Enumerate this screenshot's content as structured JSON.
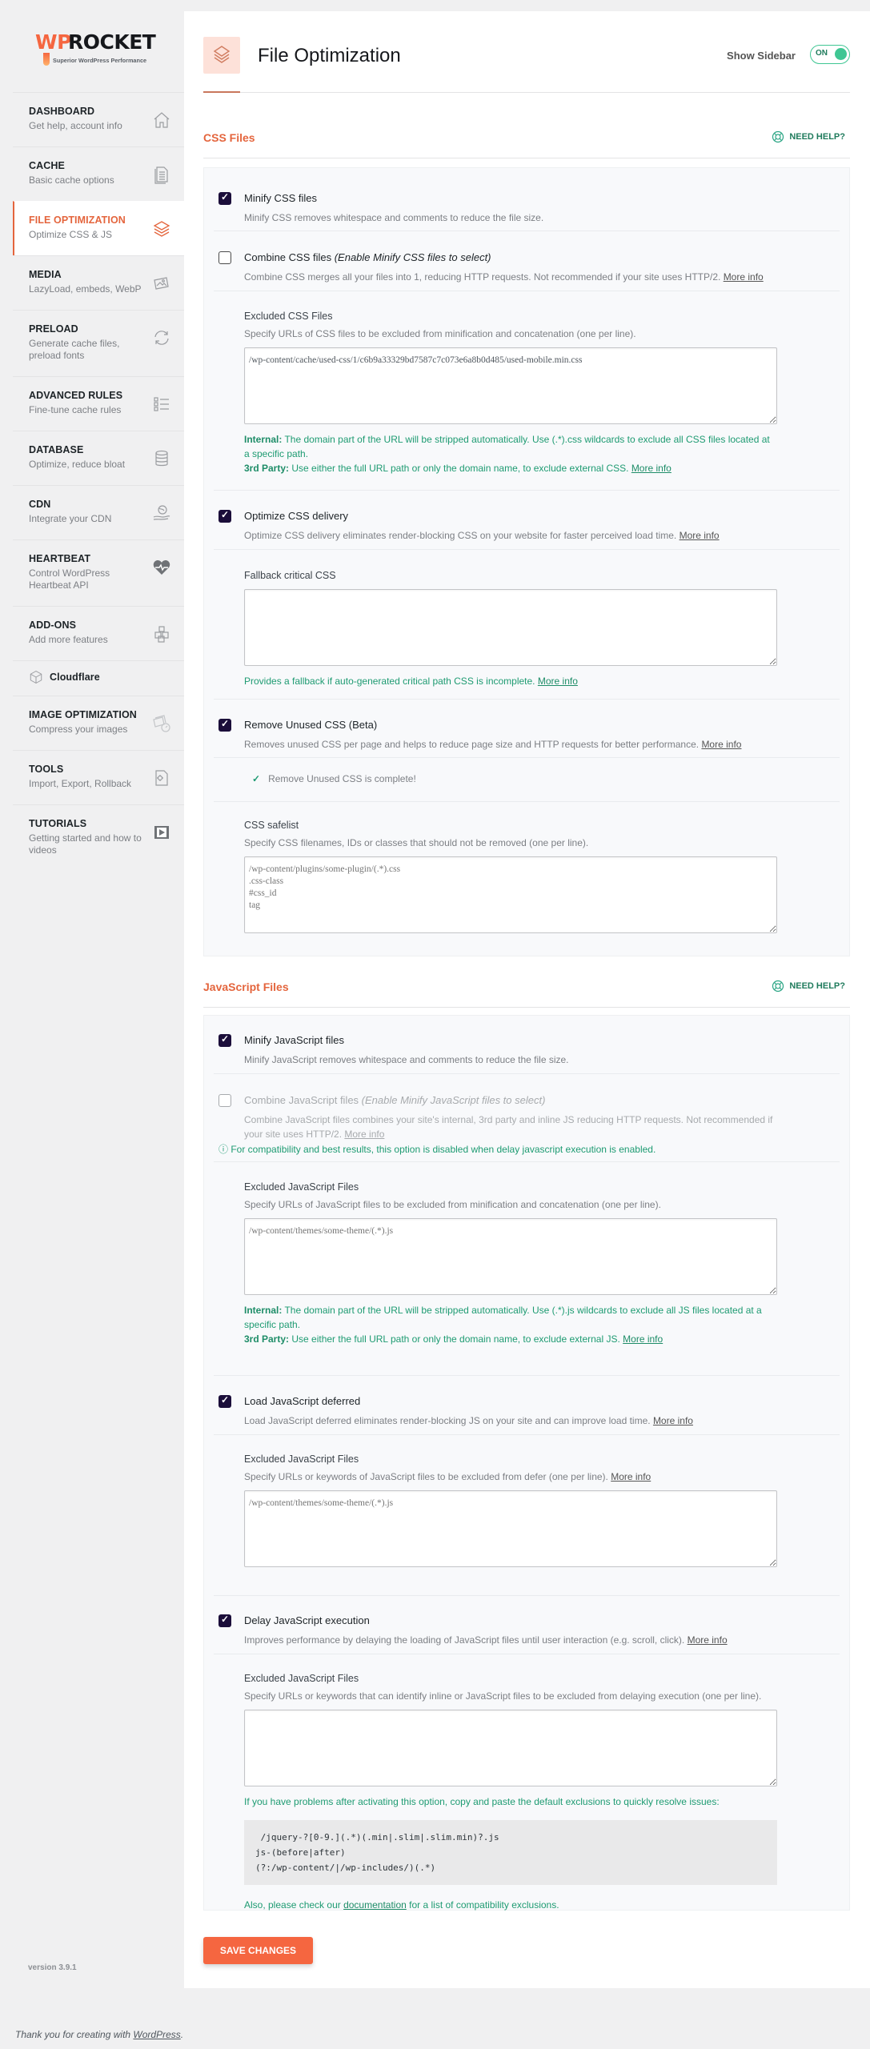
{
  "brand": {
    "logo_primary": "WP",
    "logo_secondary": "ROCKET",
    "tagline": "Superior WordPress Performance",
    "accent_color": "#f56640",
    "success_color": "#3fc693",
    "checkbox_color": "#1b0e3a"
  },
  "sidebar": {
    "items": [
      {
        "title": "DASHBOARD",
        "subtitle": "Get help, account info",
        "icon": "home-icon"
      },
      {
        "title": "CACHE",
        "subtitle": "Basic cache options",
        "icon": "document-icon"
      },
      {
        "title": "FILE OPTIMIZATION",
        "subtitle": "Optimize CSS & JS",
        "icon": "layers-icon",
        "active": true
      },
      {
        "title": "MEDIA",
        "subtitle": "LazyLoad, embeds, WebP",
        "icon": "images-icon"
      },
      {
        "title": "PRELOAD",
        "subtitle": "Generate cache files, preload fonts",
        "icon": "refresh-icon"
      },
      {
        "title": "ADVANCED RULES",
        "subtitle": "Fine-tune cache rules",
        "icon": "checklist-icon"
      },
      {
        "title": "DATABASE",
        "subtitle": "Optimize, reduce bloat",
        "icon": "database-icon"
      },
      {
        "title": "CDN",
        "subtitle": "Integrate your CDN",
        "icon": "globe-hand-icon"
      },
      {
        "title": "HEARTBEAT",
        "subtitle": "Control WordPress Heartbeat API",
        "icon": "heartbeat-icon"
      },
      {
        "title": "ADD-ONS",
        "subtitle": "Add more features",
        "icon": "cubes-icon"
      },
      {
        "title": "Cloudflare",
        "subtitle": "",
        "icon": "cube-icon"
      },
      {
        "title": "IMAGE OPTIMIZATION",
        "subtitle": "Compress your images",
        "icon": "image-compress-icon"
      },
      {
        "title": "TOOLS",
        "subtitle": "Import, Export, Rollback",
        "icon": "file-gear-icon"
      },
      {
        "title": "TUTORIALS",
        "subtitle": "Getting started and how to videos",
        "icon": "video-icon"
      }
    ],
    "version": "version 3.9.1"
  },
  "header": {
    "title": "File Optimization",
    "show_sidebar_label": "Show Sidebar",
    "toggle_state": "ON"
  },
  "css_section": {
    "title": "CSS Files",
    "help_label": "NEED HELP?",
    "minify": {
      "label": "Minify CSS files",
      "checked": true,
      "desc": "Minify CSS removes whitespace and comments to reduce the file size."
    },
    "combine": {
      "label": "Combine CSS files ",
      "label_hint": "(Enable Minify CSS files to select)",
      "checked": false,
      "desc": "Combine CSS merges all your files into 1, reducing HTTP requests. Not recommended if your site uses HTTP/2. ",
      "more": "More info"
    },
    "excluded": {
      "title": "Excluded CSS Files",
      "desc": "Specify URLs of CSS files to be excluded from minification and concatenation (one per line).",
      "value": "/wp-content/cache/used-css/1/c6b9a33329bd7587c7c073e6a8b0d485/used-mobile.min.css",
      "internal_label": "Internal:",
      "internal_text": " The domain part of the URL will be stripped automatically. Use (.*).css wildcards to exclude all CSS files located at a specific path.",
      "third_label": "3rd Party:",
      "third_text": " Use either the full URL path or only the domain name, to exclude external CSS. ",
      "more": "More info"
    },
    "optimize_delivery": {
      "label": "Optimize CSS delivery",
      "checked": true,
      "desc": "Optimize CSS delivery eliminates render-blocking CSS on your website for faster perceived load time. ",
      "more": "More info"
    },
    "fallback": {
      "title": "Fallback critical CSS",
      "value": "",
      "note": "Provides a fallback if auto-generated critical path CSS is incomplete. ",
      "more": "More info"
    },
    "remove_unused": {
      "label": "Remove Unused CSS (Beta)",
      "checked": true,
      "desc": "Removes unused CSS per page and helps to reduce page size and HTTP requests for better performance. ",
      "more": "More info"
    },
    "status": "Remove Unused CSS is complete!",
    "safelist": {
      "title": "CSS safelist",
      "desc": "Specify CSS filenames, IDs or classes that should not be removed (one per line).",
      "placeholder": "/wp-content/plugins/some-plugin/(.*).css\n.css-class\n#css_id\ntag"
    }
  },
  "js_section": {
    "title": "JavaScript Files",
    "help_label": "NEED HELP?",
    "minify": {
      "label": "Minify JavaScript files",
      "checked": true,
      "desc": "Minify JavaScript removes whitespace and comments to reduce the file size."
    },
    "combine": {
      "label": "Combine JavaScript files ",
      "label_hint": "(Enable Minify JavaScript files to select)",
      "checked": false,
      "disabled": true,
      "desc": "Combine JavaScript files combines your site's internal, 3rd party and inline JS reducing HTTP requests. Not recommended if your site uses HTTP/2. ",
      "more": "More info",
      "warning": "For compatibility and best results, this option is disabled when delay javascript execution is enabled."
    },
    "excluded": {
      "title": "Excluded JavaScript Files",
      "desc": "Specify URLs of JavaScript files to be excluded from minification and concatenation (one per line).",
      "placeholder": "/wp-content/themes/some-theme/(.*).js",
      "internal_label": "Internal:",
      "internal_text": " The domain part of the URL will be stripped automatically. Use (.*).js wildcards to exclude all JS files located at a specific path.",
      "third_label": "3rd Party:",
      "third_text": " Use either the full URL path or only the domain name, to exclude external JS. ",
      "more": "More info"
    },
    "defer": {
      "label": "Load JavaScript deferred",
      "checked": true,
      "desc": "Load JavaScript deferred eliminates render-blocking JS on your site and can improve load time. ",
      "more": "More info"
    },
    "defer_excluded": {
      "title": "Excluded JavaScript Files",
      "desc": "Specify URLs or keywords of JavaScript files to be excluded from defer (one per line). ",
      "more": "More info",
      "placeholder": "/wp-content/themes/some-theme/(.*).js"
    },
    "delay": {
      "label": "Delay JavaScript execution",
      "checked": true,
      "desc": "Improves performance by delaying the loading of JavaScript files until user interaction (e.g. scroll, click). ",
      "more": "More info"
    },
    "delay_excluded": {
      "title": "Excluded JavaScript Files",
      "desc": "Specify URLs or keywords that can identify inline or JavaScript files to be excluded from delaying execution (one per line).",
      "value": "",
      "note": "If you have problems after activating this option, copy and paste the default exclusions to quickly resolve issues:",
      "code": " /jquery-?[0-9.](.*)(.min|.slim|.slim.min)?.js\njs-(before|after)\n(?:/wp-content/|/wp-includes/)(.*)",
      "also_pre": "Also, please check our ",
      "also_link": "documentation",
      "also_post": " for a list of compatibility exclusions."
    }
  },
  "save_button": "SAVE CHANGES",
  "footer": {
    "text": "Thank you for creating with ",
    "link": "WordPress",
    "suffix": "."
  }
}
